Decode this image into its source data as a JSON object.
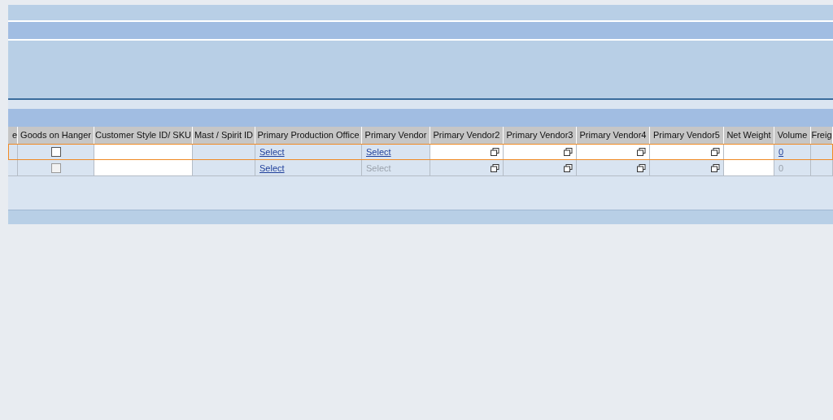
{
  "table": {
    "columns": [
      "e",
      "Goods on Hanger",
      "Customer Style ID/ SKU",
      "Mast / Spirit ID",
      "Primary Production Office",
      "Primary Vendor",
      "Primary Vendor2",
      "Primary Vendor3",
      "Primary Vendor4",
      "Primary Vendor5",
      "Net Weight",
      "Volume",
      "Freig"
    ],
    "rows": [
      {
        "selected": true,
        "cells": [
          {
            "kind": "blank"
          },
          {
            "kind": "checkbox",
            "checked": false,
            "disabled": false
          },
          {
            "kind": "input",
            "disabled": false
          },
          {
            "kind": "blank"
          },
          {
            "kind": "link",
            "text": "Select",
            "disabled": false
          },
          {
            "kind": "link",
            "text": "Select",
            "disabled": false
          },
          {
            "kind": "lookup",
            "disabled": false
          },
          {
            "kind": "lookup",
            "disabled": false
          },
          {
            "kind": "lookup",
            "disabled": false
          },
          {
            "kind": "lookup",
            "disabled": false
          },
          {
            "kind": "input",
            "disabled": false
          },
          {
            "kind": "link",
            "text": "0",
            "disabled": false
          },
          {
            "kind": "blank"
          }
        ]
      },
      {
        "selected": false,
        "cells": [
          {
            "kind": "blank"
          },
          {
            "kind": "checkbox",
            "checked": false,
            "disabled": true
          },
          {
            "kind": "input",
            "disabled": false
          },
          {
            "kind": "blank"
          },
          {
            "kind": "link",
            "text": "Select",
            "disabled": false
          },
          {
            "kind": "link",
            "text": "Select",
            "disabled": true
          },
          {
            "kind": "lookup",
            "disabled": true
          },
          {
            "kind": "lookup",
            "disabled": true
          },
          {
            "kind": "lookup",
            "disabled": true
          },
          {
            "kind": "lookup",
            "disabled": true
          },
          {
            "kind": "input",
            "disabled": false
          },
          {
            "kind": "link",
            "text": "0",
            "disabled": true
          },
          {
            "kind": "blank"
          }
        ]
      }
    ]
  }
}
